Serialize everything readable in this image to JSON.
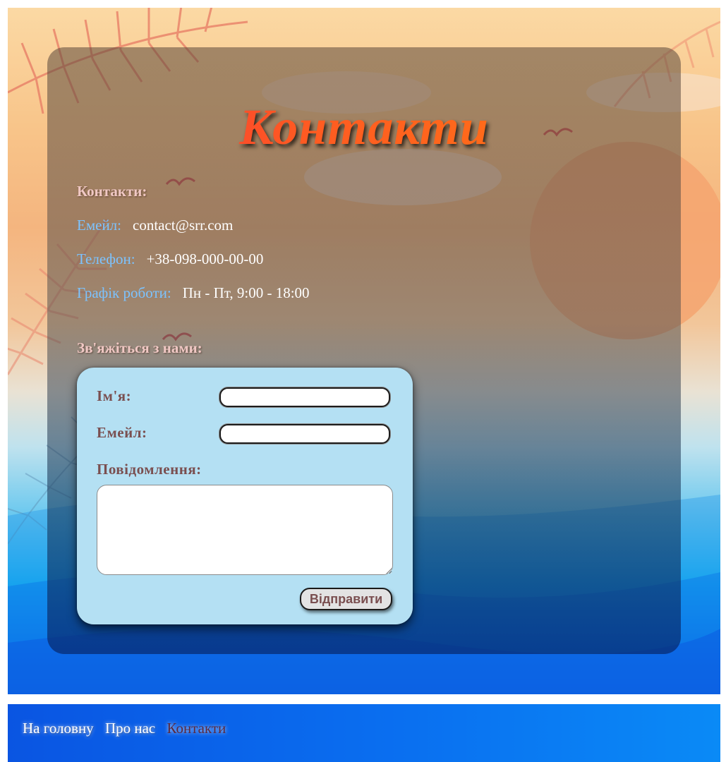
{
  "page": {
    "title": "Контакти"
  },
  "contacts": {
    "heading": "Контакти:",
    "email_label": "Емейл:",
    "email_value": "contact@srr.com",
    "phone_label": "Телефон:",
    "phone_value": "+38-098-000-00-00",
    "hours_label": "Графік роботи:",
    "hours_value": "Пн - Пт, 9:00 - 18:00"
  },
  "form": {
    "heading": "Зв'яжіться з нами:",
    "name_label": "Ім'я:",
    "name_value": "",
    "email_label": "Емейл:",
    "email_value": "",
    "message_label": "Повідомлення:",
    "message_value": "",
    "submit_label": "Відправити"
  },
  "footer": {
    "nav": [
      {
        "label": "На головну",
        "active": false
      },
      {
        "label": "Про нас",
        "active": false
      },
      {
        "label": "Контакти",
        "active": true
      }
    ]
  },
  "colors": {
    "panel_overlay": "#5c483a",
    "link_label": "#7cc3ff",
    "form_card": "#b4e0f3",
    "form_text": "#7a4f50",
    "footer_blue": "#0a6ff0",
    "title_gradient_start": "#f02a3e",
    "title_gradient_end": "#ff7a12"
  }
}
